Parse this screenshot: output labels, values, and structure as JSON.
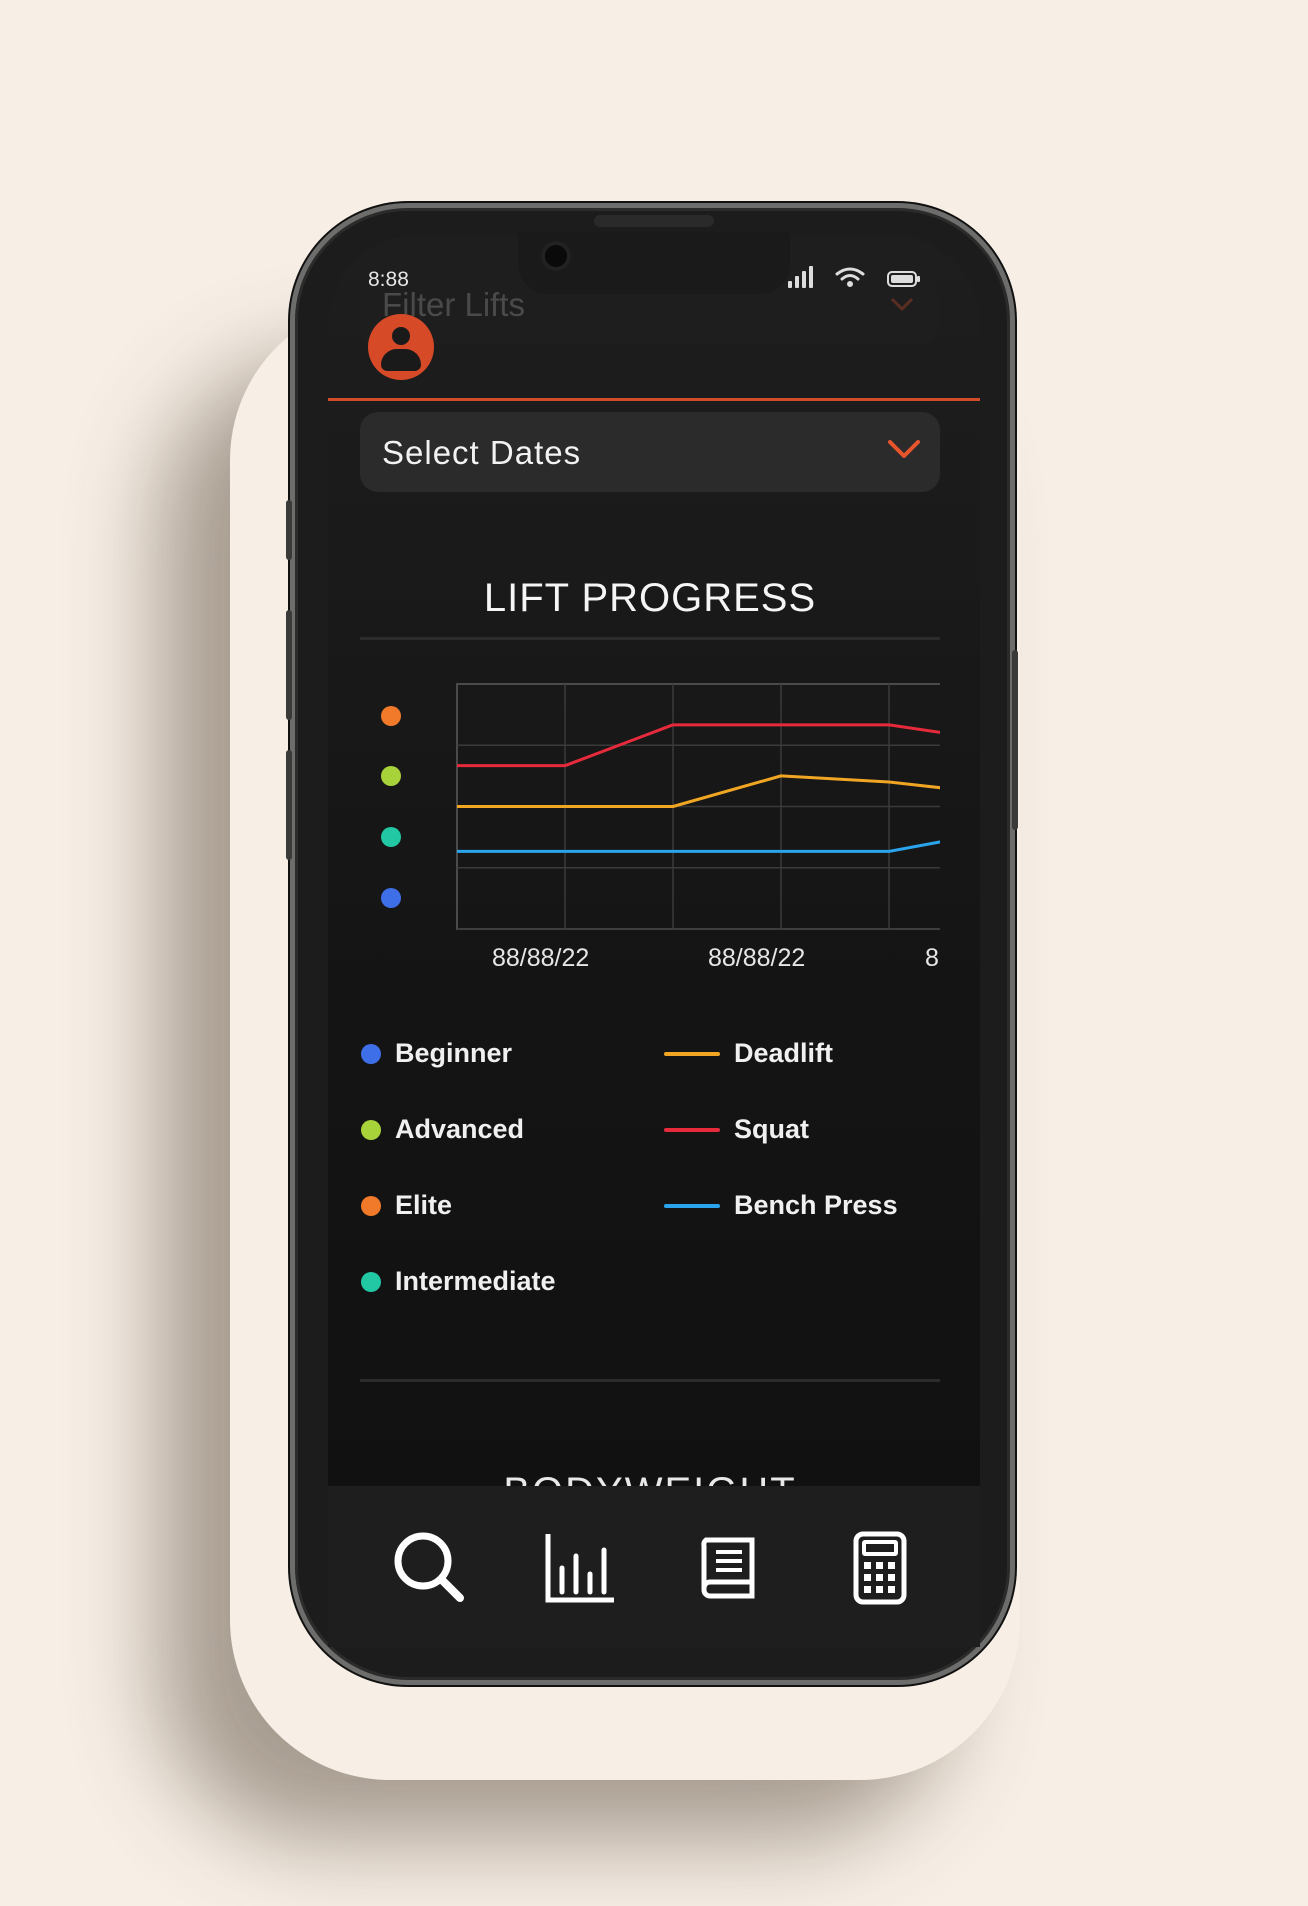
{
  "status_bar": {
    "time": "8:88",
    "signal_icon": "signal-icon",
    "wifi_icon": "wifi-icon",
    "battery_icon": "battery-icon"
  },
  "header": {
    "filter_label": "Filter Lifts",
    "avatar_icon": "user-icon"
  },
  "date_select": {
    "label": "Select Dates"
  },
  "lift_progress": {
    "title": "LIFT PROGRESS"
  },
  "levels": [
    {
      "label": "Elite",
      "color": "#f07a2a"
    },
    {
      "label": "Advanced",
      "color": "#a8d23a"
    },
    {
      "label": "Intermediate",
      "color": "#22c7a3"
    },
    {
      "label": "Beginner",
      "color": "#3f6fe8"
    }
  ],
  "legend_levels": [
    {
      "label": "Beginner",
      "color": "#3f6fe8"
    },
    {
      "label": "Advanced",
      "color": "#a8d23a"
    },
    {
      "label": "Elite",
      "color": "#f07a2a"
    },
    {
      "label": "Intermediate",
      "color": "#22c7a3"
    }
  ],
  "chart_data": {
    "type": "line",
    "x": [
      "88/88/22",
      "",
      "88/88/22",
      "",
      "8"
    ],
    "series": [
      {
        "name": "Squat",
        "color": "#e62a3c",
        "values": [
          4.0,
          4.0,
          5.0,
          5.0,
          5.0,
          4.8
        ]
      },
      {
        "name": "Deadlift",
        "color": "#f0a623",
        "values": [
          3.0,
          3.0,
          3.0,
          3.75,
          3.6,
          3.45
        ]
      },
      {
        "name": "Bench Press",
        "color": "#2aa4ec",
        "values": [
          1.9,
          1.9,
          1.9,
          1.9,
          1.9,
          2.15
        ]
      }
    ],
    "ylim": [
      0,
      6
    ],
    "grid": true
  },
  "bodyweight": {
    "title": "BODYWEIGHT"
  },
  "tabbar": [
    {
      "name": "search",
      "icon": "search-icon"
    },
    {
      "name": "stats",
      "icon": "bar-chart-icon"
    },
    {
      "name": "log",
      "icon": "book-icon"
    },
    {
      "name": "calculator",
      "icon": "calculator-icon"
    }
  ]
}
